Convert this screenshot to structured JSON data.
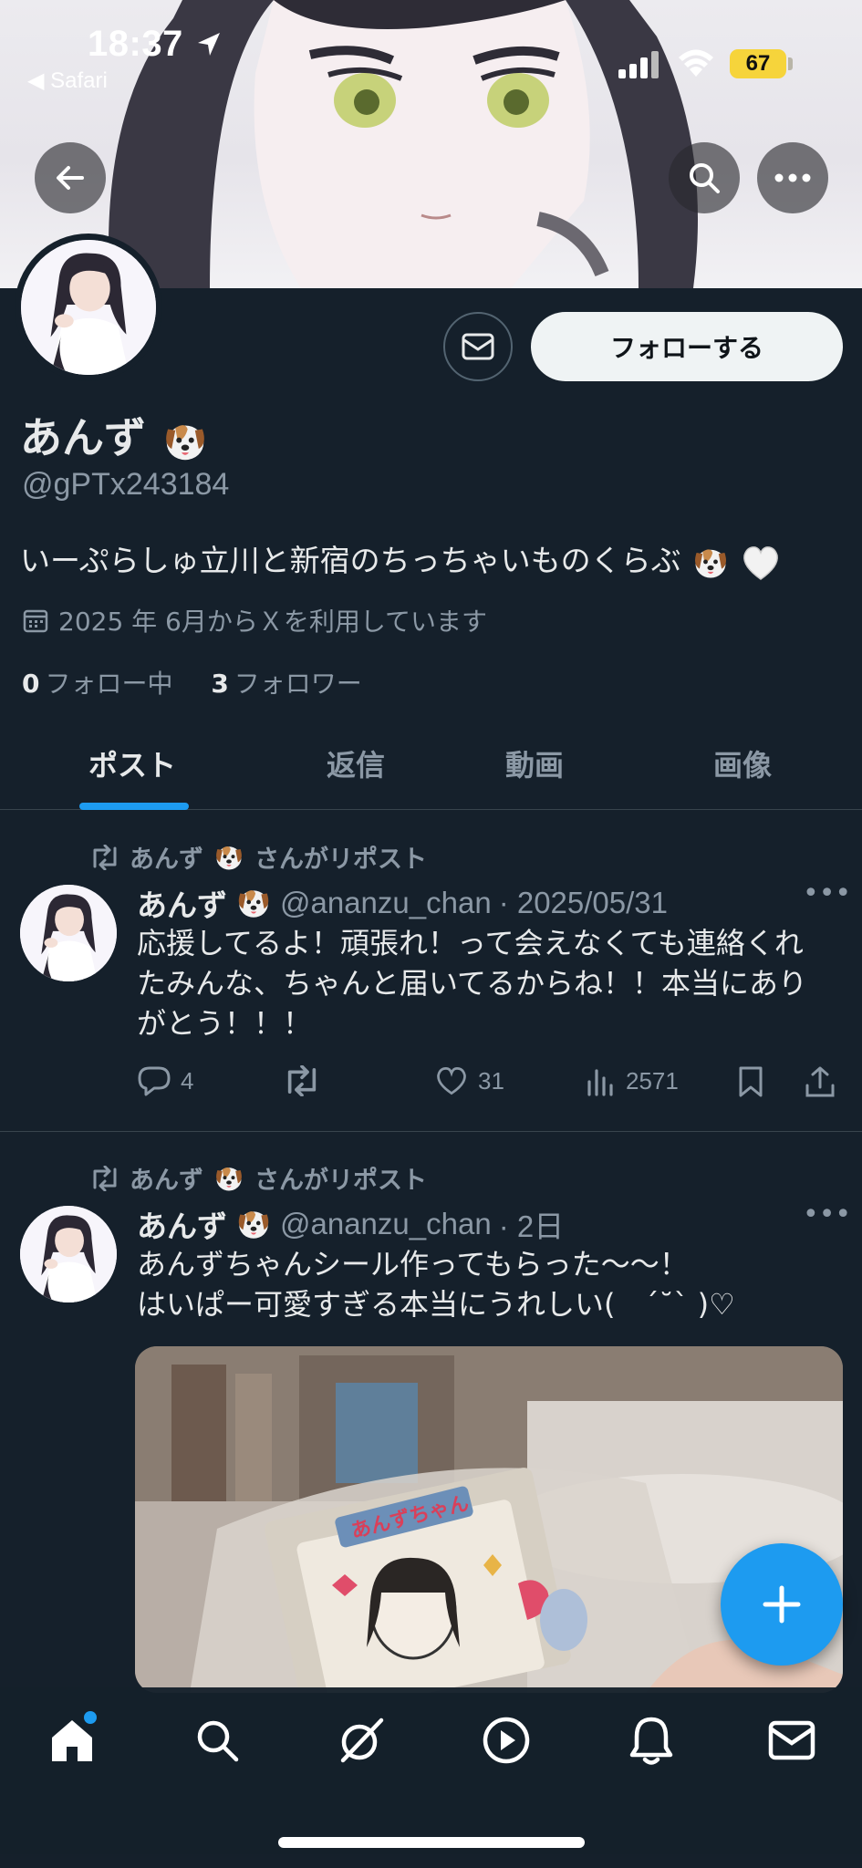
{
  "status_bar": {
    "time": "18:37",
    "back_app": "◀ Safari",
    "battery": "67"
  },
  "profile": {
    "display_name": "あんず",
    "name_emoji": "dog-face-icon",
    "handle": "@gPTx243184",
    "bio": "いーぷらしゅ立川と新宿のちっちゃいものくらぶ",
    "bio_emojis": [
      "dog-face-icon",
      "white-heart-icon"
    ],
    "joined": "2025 年 6月からＸを利用しています",
    "following_count": "0",
    "following_label": "フォロー中",
    "followers_count": "3",
    "followers_label": "フォロワー",
    "follow_button": "フォローする"
  },
  "tabs": [
    {
      "label": "ポスト",
      "active": true
    },
    {
      "label": "返信",
      "active": false
    },
    {
      "label": "動画",
      "active": false
    },
    {
      "label": "画像",
      "active": false
    }
  ],
  "posts": [
    {
      "repost_label": "さんがリポスト",
      "repost_name": "あんず",
      "author_name": "あんず",
      "author_handle": "@ananzu_chan",
      "date": "· 2025/05/31",
      "text": "応援してるよ！頑張れ！って会えなくても連絡くれたみんな、ちゃんと届いてるからね！！本当にありがとう！！！",
      "replies": "4",
      "reposts": "",
      "likes": "31",
      "views": "2571"
    },
    {
      "repost_label": "さんがリポスト",
      "repost_name": "あんず",
      "author_name": "あんず",
      "author_handle": "@ananzu_chan",
      "date": "· 2日",
      "text_line1": "あんずちゃんシール作ってもらった〜〜！",
      "text_line2": "はいぱー可愛すぎる本当にうれしい(　´˘` )♡",
      "image_text": "あんずちゃん"
    }
  ],
  "colors": {
    "background": "#15202b",
    "accent": "#1d9bf0",
    "secondary_text": "#8b98a5",
    "battery": "#f6d43b"
  },
  "bottom_nav": [
    "home-icon",
    "search-icon",
    "grok-icon",
    "video-icon",
    "notifications-icon",
    "messages-icon"
  ]
}
